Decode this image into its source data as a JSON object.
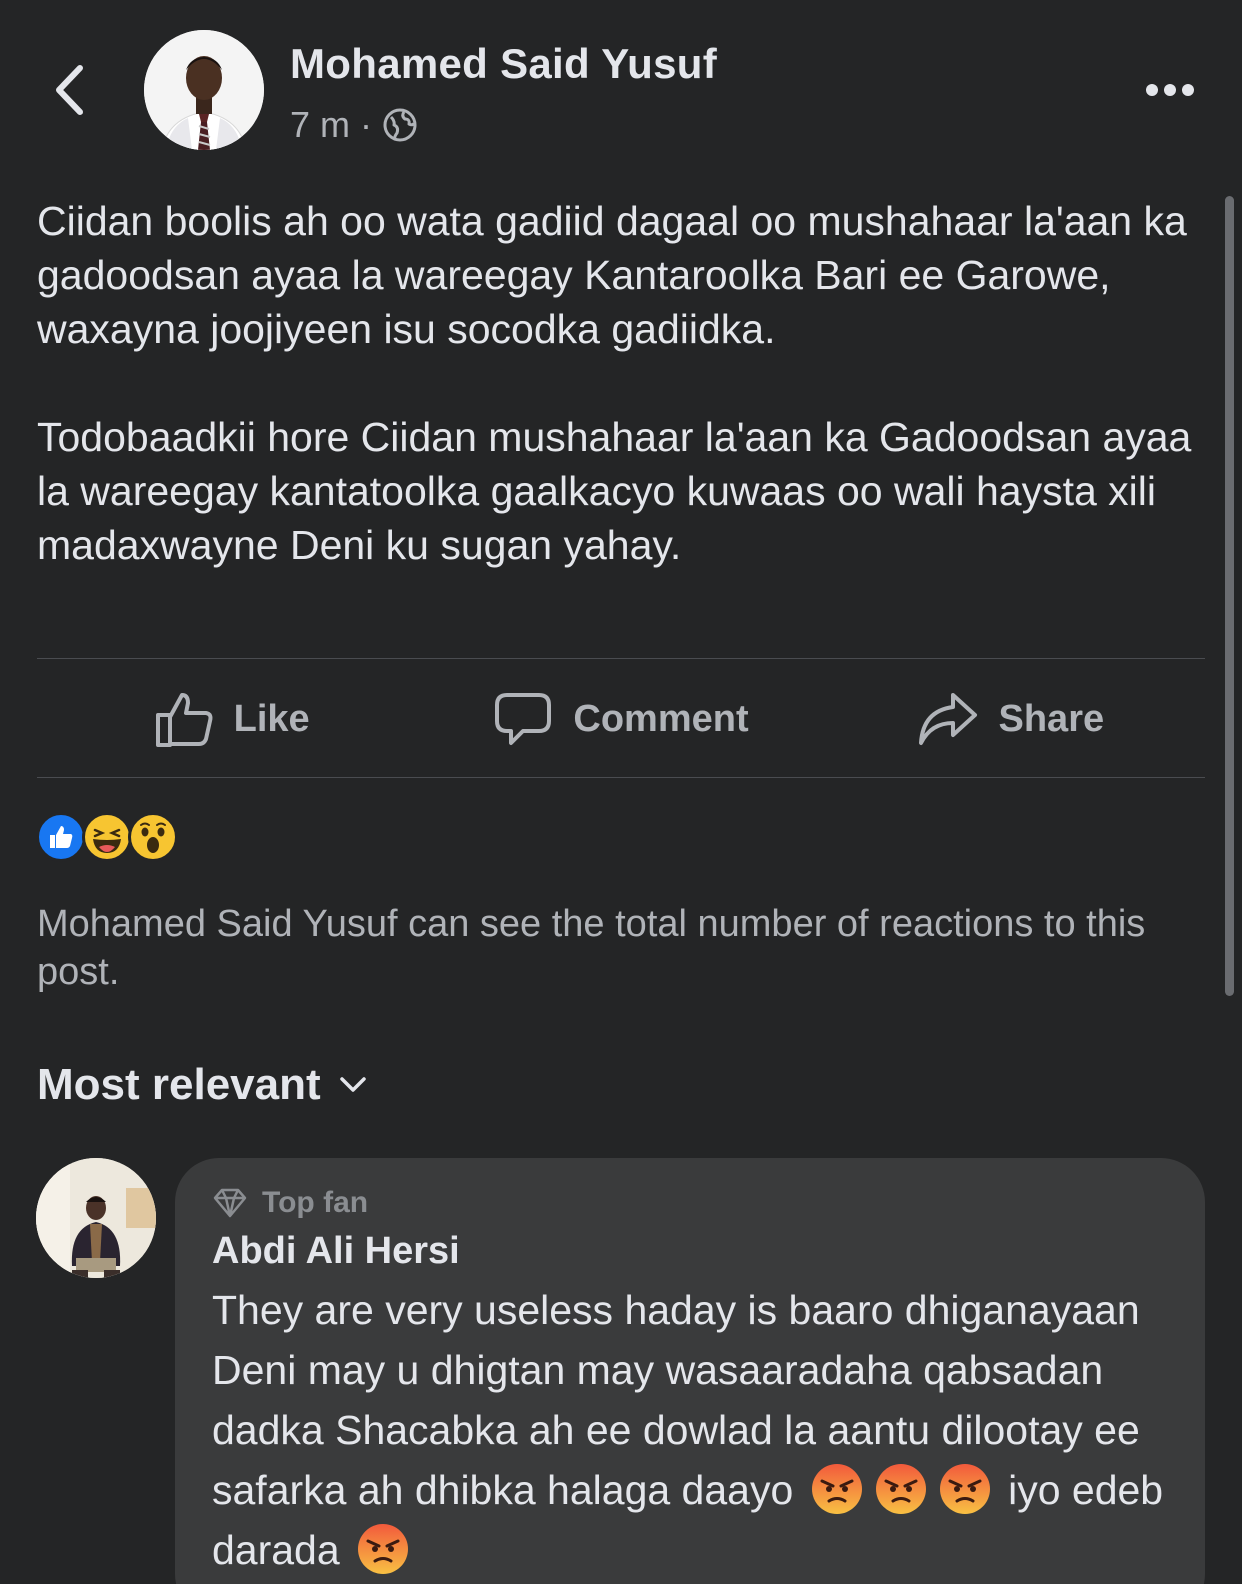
{
  "post": {
    "author": "Mohamed Said Yusuf",
    "time": "7 m",
    "separator": "·",
    "privacy_icon": "globe-icon",
    "paragraphs": [
      "Ciidan boolis ah oo wata gadiid dagaal oo mushahaar la'aan ka gadoodsan ayaa la wareegay Kantaroolka Bari ee Garowe, waxayna joojiyeen isu socodka gadiidka.",
      "Todobaadkii hore Ciidan mushahaar la'aan ka Gadoodsan ayaa la wareegay kantatoolka gaalkacyo kuwaas oo wali haysta xili madaxwayne Deni ku sugan yahay."
    ]
  },
  "actions": {
    "like": "Like",
    "comment": "Comment",
    "share": "Share"
  },
  "reactions": [
    "like",
    "haha",
    "wow"
  ],
  "reactions_note": "Mohamed Said Yusuf can see the total number of reactions to this post.",
  "sort_label": "Most relevant",
  "comment": {
    "badge": "Top fan",
    "author": "Abdi Ali Hersi",
    "text_part1": "They are very useless haday is baaro dhiganayaan Deni may u dhigtan may wasaaradaha qabsadan dadka Shacabka ah ee dowlad la aantu dilootay ee safarka ah dhibka halaga daayo",
    "text_part2": "iyo edeb darada"
  },
  "colors": {
    "background": "#242526",
    "text": "#e4e6eb",
    "secondary_text": "#b0b3b8",
    "bubble": "#3a3b3c",
    "like_blue": "#1877f2"
  }
}
